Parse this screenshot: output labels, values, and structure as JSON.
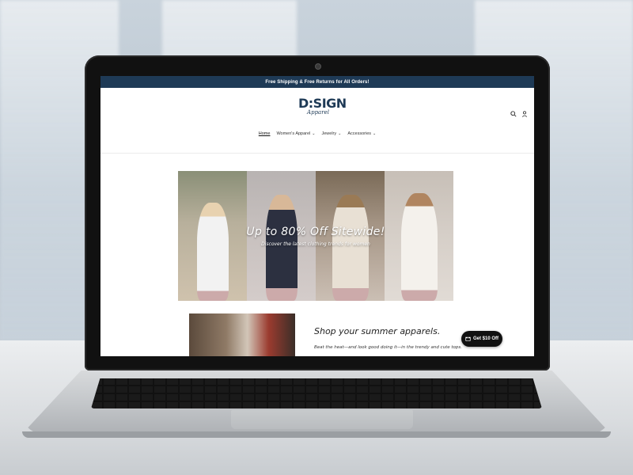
{
  "announcement": {
    "text": "Free Shipping & Free Returns for All Orders!"
  },
  "brand": {
    "logo_main": "D:SIGN",
    "logo_sub": "Apparel",
    "color": "#1e3a56"
  },
  "header": {
    "icons": [
      "search-icon",
      "account-icon"
    ]
  },
  "nav": {
    "items": [
      {
        "label": "Home",
        "active": true,
        "has_dropdown": false
      },
      {
        "label": "Women's Apparel",
        "active": false,
        "has_dropdown": true
      },
      {
        "label": "Jewelry",
        "active": false,
        "has_dropdown": true
      },
      {
        "label": "Accessories",
        "active": false,
        "has_dropdown": true
      }
    ],
    "caret": "⌄"
  },
  "hero": {
    "title": "Up to 80% Off Sitewide!",
    "subtitle": "Discover the latest clothing trends for women"
  },
  "promo": {
    "title": "Shop your summer apparels.",
    "text": "Beat the heat—and look good doing it—in the trendy and cute tops."
  },
  "coupon": {
    "label": "Get $10 Off",
    "icon": "gift-icon"
  }
}
